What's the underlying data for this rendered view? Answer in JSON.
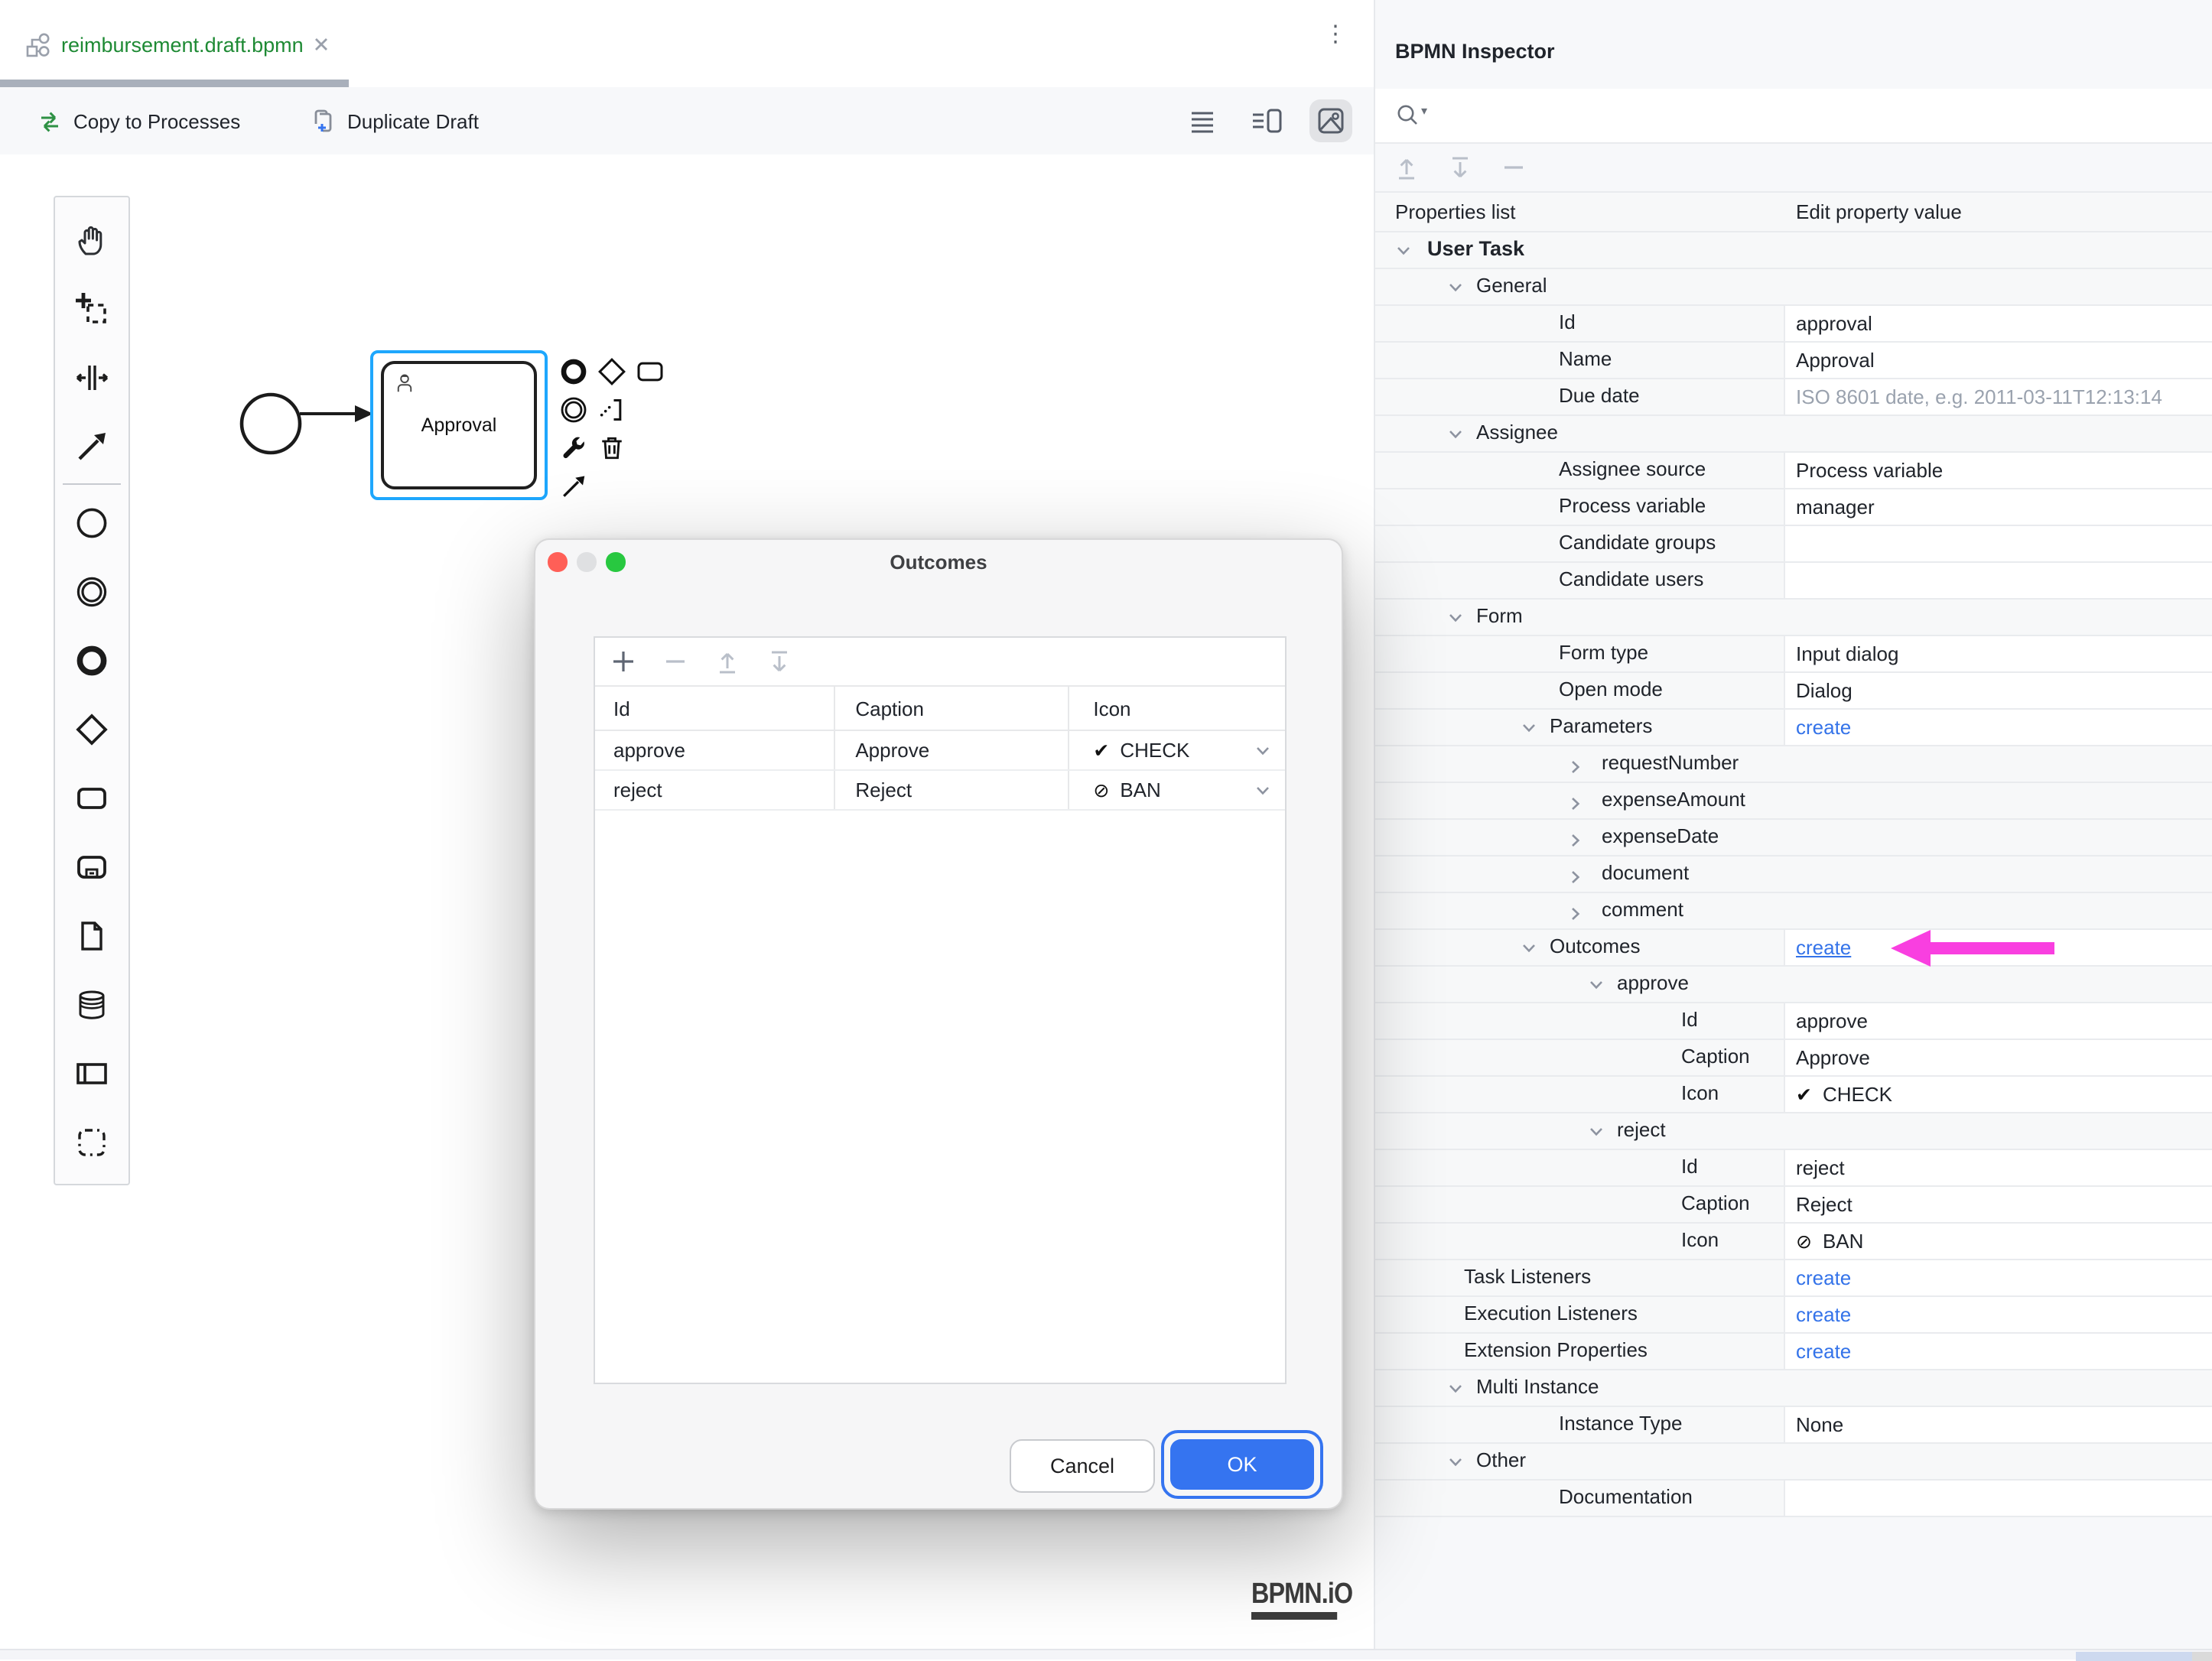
{
  "tab": {
    "title": "reimbursement.draft.bpmn"
  },
  "editor_toolbar": {
    "copy_to_processes": "Copy to Processes",
    "duplicate_draft": "Duplicate Draft"
  },
  "canvas": {
    "task_name": "Approval",
    "logo_text": "BPMN.iO"
  },
  "modal": {
    "title": "Outcomes",
    "table": {
      "columns": [
        "Id",
        "Caption",
        "Icon"
      ],
      "rows": [
        {
          "id": "approve",
          "caption": "Approve",
          "icon": "CHECK"
        },
        {
          "id": "reject",
          "caption": "Reject",
          "icon": "BAN"
        }
      ]
    },
    "cancel_label": "Cancel",
    "ok_label": "OK"
  },
  "inspector": {
    "title": "BPMN Inspector",
    "columns": {
      "left": "Properties list",
      "right": "Edit property value"
    },
    "rows": [
      {
        "label": "User Task",
        "lv": "0",
        "ch": "d",
        "bold": true,
        "full": true
      },
      {
        "label": "General",
        "lv": "1",
        "ch": "d",
        "full": true
      },
      {
        "label": "Id",
        "lv": "2",
        "v": "approval"
      },
      {
        "label": "Name",
        "lv": "2",
        "v": "Approval"
      },
      {
        "label": "Due date",
        "lv": "2",
        "v": "ISO 8601 date, e.g. 2011-03-11T12:13:14",
        "vt": "ph"
      },
      {
        "label": "Assignee",
        "lv": "1",
        "ch": "d",
        "full": true
      },
      {
        "label": "Assignee source",
        "lv": "2",
        "v": "Process variable"
      },
      {
        "label": "Process variable",
        "lv": "2",
        "v": "manager"
      },
      {
        "label": "Candidate groups",
        "lv": "2",
        "v": ""
      },
      {
        "label": "Candidate users",
        "lv": "2",
        "v": ""
      },
      {
        "label": "Form",
        "lv": "1",
        "ch": "d",
        "full": true
      },
      {
        "label": "Form type",
        "lv": "2",
        "v": "Input dialog"
      },
      {
        "label": "Open mode",
        "lv": "2",
        "v": "Dialog"
      },
      {
        "label": "Parameters",
        "lv": "2g",
        "ch": "d",
        "v": "create",
        "vt": "link"
      },
      {
        "label": "requestNumber",
        "lv": "3",
        "ch": "r",
        "full": true
      },
      {
        "label": "expenseAmount",
        "lv": "3",
        "ch": "r",
        "full": true
      },
      {
        "label": "expenseDate",
        "lv": "3",
        "ch": "r",
        "full": true
      },
      {
        "label": "document",
        "lv": "3",
        "ch": "r",
        "full": true
      },
      {
        "label": "comment",
        "lv": "3",
        "ch": "r",
        "full": true
      },
      {
        "label": "Outcomes",
        "lv": "2g",
        "ch": "d",
        "v": "create",
        "vt": "linku",
        "arrow": true
      },
      {
        "label": "approve",
        "lv": "3g",
        "ch": "d",
        "full": true
      },
      {
        "label": "Id",
        "lv": "4",
        "v": "approve"
      },
      {
        "label": "Caption",
        "lv": "4",
        "v": "Approve"
      },
      {
        "label": "Icon",
        "lv": "4",
        "v": "CHECK",
        "vt": "check"
      },
      {
        "label": "reject",
        "lv": "3g",
        "ch": "d",
        "full": true
      },
      {
        "label": "Id",
        "lv": "4",
        "v": "reject"
      },
      {
        "label": "Caption",
        "lv": "4",
        "v": "Reject"
      },
      {
        "label": "Icon",
        "lv": "4",
        "v": "BAN",
        "vt": "ban"
      },
      {
        "label": "Task Listeners",
        "lv": "ls",
        "v": "create",
        "vt": "link"
      },
      {
        "label": "Execution Listeners",
        "lv": "ls",
        "v": "create",
        "vt": "link"
      },
      {
        "label": "Extension Properties",
        "lv": "ls",
        "v": "create",
        "vt": "link"
      },
      {
        "label": "Multi Instance",
        "lv": "1",
        "ch": "d",
        "full": true
      },
      {
        "label": "Instance Type",
        "lv": "2",
        "v": "None"
      },
      {
        "label": "Other",
        "lv": "1",
        "ch": "d",
        "full": true
      },
      {
        "label": "Documentation",
        "lv": "2",
        "v": ""
      }
    ]
  },
  "icons": {
    "kebab": "⋮",
    "search_caret": "▾",
    "check": "✔",
    "ban": "⊘"
  },
  "colors": {
    "accent_blue": "#3574f0",
    "link_blue": "#3473e9",
    "selection_blue": "#1ea7fd",
    "tab_green": "#1e8a34",
    "arrow_magenta": "#f93fe0",
    "traffic_red": "#ff5f57",
    "traffic_gray": "#dfe0e2",
    "traffic_green": "#28c840"
  }
}
